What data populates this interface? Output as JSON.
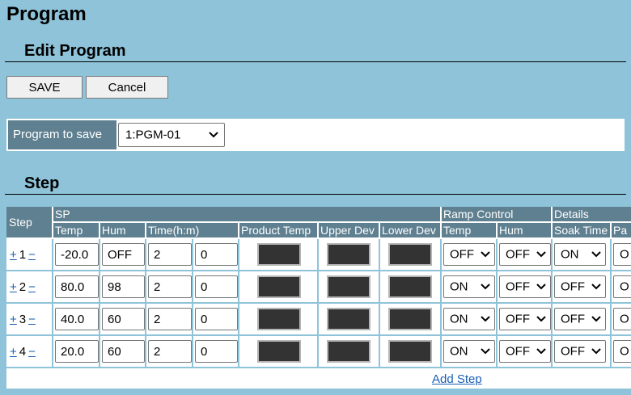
{
  "page": {
    "title": "Program"
  },
  "edit": {
    "title": "Edit Program",
    "save_label": "SAVE",
    "cancel_label": "Cancel"
  },
  "save_to": {
    "label": "Program to save",
    "value": "1:PGM-01"
  },
  "step": {
    "title": "Step",
    "header": {
      "step": "Step",
      "sp": "SP",
      "ramp": "Ramp Control",
      "details": "Details",
      "temp": "Temp",
      "hum": "Hum",
      "time": "Time(h:m)",
      "product_temp": "Product Temp",
      "upper_dev": "Upper Dev",
      "lower_dev": "Lower Dev",
      "ramp_temp": "Temp",
      "ramp_hum": "Hum",
      "soak_time": "Soak Time",
      "pa": "Pa"
    },
    "rows": [
      {
        "plus": "+",
        "num": "1",
        "minus": "−",
        "temp": "-20.0",
        "hum": "OFF",
        "hours": "2",
        "mins": "0",
        "ramp_temp": "OFF",
        "ramp_hum": "OFF",
        "soak": "ON",
        "extra": "O"
      },
      {
        "plus": "+",
        "num": "2",
        "minus": "−",
        "temp": "80.0",
        "hum": "98",
        "hours": "2",
        "mins": "0",
        "ramp_temp": "ON",
        "ramp_hum": "OFF",
        "soak": "OFF",
        "extra": "O"
      },
      {
        "plus": "+",
        "num": "3",
        "minus": "−",
        "temp": "40.0",
        "hum": "60",
        "hours": "2",
        "mins": "0",
        "ramp_temp": "ON",
        "ramp_hum": "OFF",
        "soak": "OFF",
        "extra": "O"
      },
      {
        "plus": "+",
        "num": "4",
        "minus": "−",
        "temp": "20.0",
        "hum": "60",
        "hours": "2",
        "mins": "0",
        "ramp_temp": "ON",
        "ramp_hum": "OFF",
        "soak": "OFF",
        "extra": "O"
      }
    ],
    "add_step": "Add Step"
  }
}
